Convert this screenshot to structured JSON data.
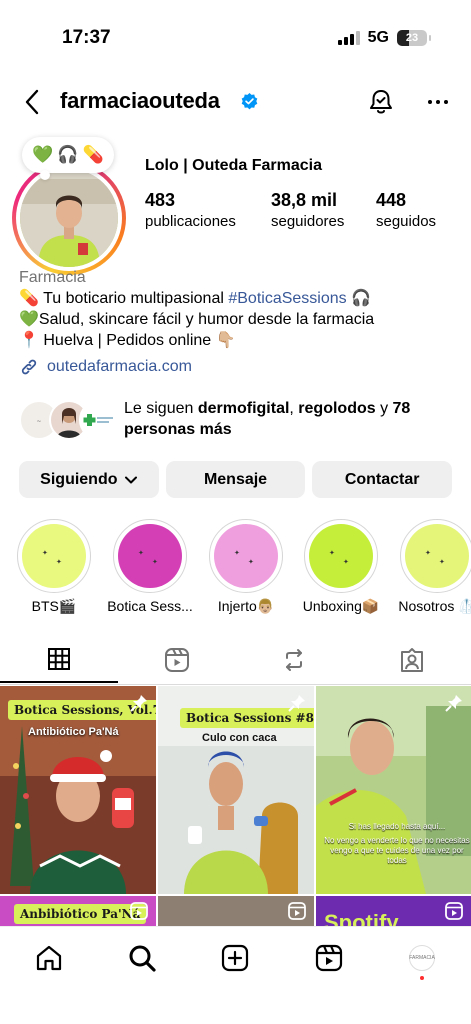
{
  "status_bar": {
    "time": "17:37",
    "network": "5G",
    "battery": "23"
  },
  "header": {
    "username": "farmaciaouteda"
  },
  "profile": {
    "note_emojis": [
      "💚",
      "🎧",
      "💊"
    ],
    "full_name": "Lolo | Outeda Farmacia",
    "stats": [
      {
        "value": "483",
        "label": "publicaciones"
      },
      {
        "value": "38,8 mil",
        "label": "seguidores"
      },
      {
        "value": "448",
        "label": "seguidos"
      }
    ],
    "category": "Farmacia",
    "bio_line1_prefix": "💊 Tu boticario multipasional ",
    "bio_line1_tag": "#BoticaSessions",
    "bio_line1_suffix": " 🎧",
    "bio_line2": "💚Salud, skincare fácil y humor desde la farmacia",
    "bio_line3": "📍 Huelva | Pedidos online 👇🏼",
    "link": "outedafarmacia.com",
    "followed_by_prefix": "Le siguen ",
    "followed_by_name1": "dermofigital",
    "followed_by_sep": ", ",
    "followed_by_name2": "regolodos",
    "followed_by_suffix_pre": " y ",
    "followed_by_more": "78 personas más"
  },
  "actions": {
    "following": "Siguiendo",
    "message": "Mensaje",
    "contact": "Contactar"
  },
  "highlights": [
    {
      "label": "BTS🎬",
      "color": "#e9f87e"
    },
    {
      "label": "Botica Sess...",
      "color": "#d43fb6"
    },
    {
      "label": "Injerto👨🏼",
      "color": "#ef9ede"
    },
    {
      "label": "Unboxing📦",
      "color": "#c4ee3a"
    },
    {
      "label": "Nosotros 🥼",
      "color": "#e4f57a"
    }
  ],
  "posts": {
    "p1_title": "Botica Sessions, Vol.7",
    "p1_sub": "Antibiótico Pa'Ná",
    "p2_title": "Botica Sessions #8",
    "p2_sub": "Culo con caca",
    "p3_caption1": "Si has llegado hasta aquí...",
    "p3_caption2": "No vengo a venderte lo que no necesitas vengo a que te cuides de una vez por todas",
    "p4_title": "Anbibiótico Pa'Ná",
    "p6_title": "Spotify"
  },
  "nav_avatar_text": "FARMACIA",
  "colors": {
    "link": "#385898",
    "verified": "#0095f6",
    "button_bg": "#efefef",
    "category": "#737373"
  }
}
